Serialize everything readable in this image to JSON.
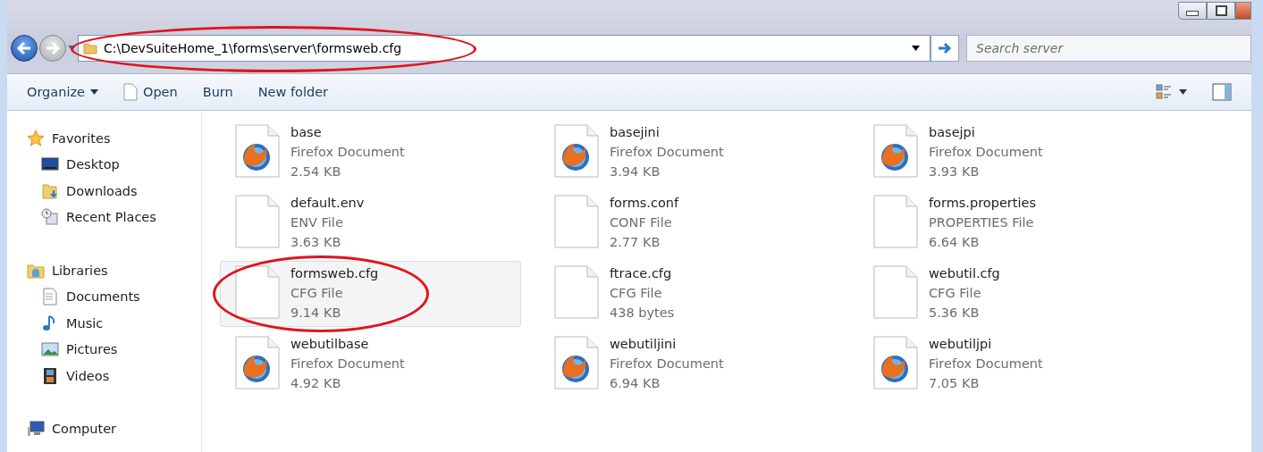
{
  "address_bar": {
    "value": "C:\\DevSuiteHome_1\\forms\\server\\formsweb.cfg",
    "circled": true
  },
  "search": {
    "placeholder": "Search server"
  },
  "toolbar": {
    "buttons": [
      "Organize",
      "Open",
      "Burn",
      "New folder"
    ]
  },
  "sidebar": {
    "groups": [
      {
        "label": "Favorites",
        "items": [
          {
            "label": "Desktop"
          },
          {
            "label": "Downloads"
          },
          {
            "label": "Recent Places"
          }
        ]
      },
      {
        "label": "Libraries",
        "items": [
          {
            "label": "Documents"
          },
          {
            "label": "Music"
          },
          {
            "label": "Pictures"
          },
          {
            "label": "Videos"
          }
        ]
      },
      {
        "label": "Computer"
      }
    ]
  },
  "files": [
    {
      "name": "base",
      "type": "Firefox Document",
      "size": "2.54 KB",
      "kind": "firefox",
      "selected": false,
      "circled": false
    },
    {
      "name": "basejini",
      "type": "Firefox Document",
      "size": "3.94 KB",
      "kind": "firefox",
      "selected": false,
      "circled": false
    },
    {
      "name": "basejpi",
      "type": "Firefox Document",
      "size": "3.93 KB",
      "kind": "firefox",
      "selected": false,
      "circled": false
    },
    {
      "name": "default.env",
      "type": "ENV File",
      "size": "3.63 KB",
      "kind": "blank",
      "selected": false,
      "circled": false
    },
    {
      "name": "forms.conf",
      "type": "CONF File",
      "size": "2.77 KB",
      "kind": "blank",
      "selected": false,
      "circled": false
    },
    {
      "name": "forms.properties",
      "type": "PROPERTIES File",
      "size": "6.64 KB",
      "kind": "blank",
      "selected": false,
      "circled": false
    },
    {
      "name": "formsweb.cfg",
      "type": "CFG File",
      "size": "9.14 KB",
      "kind": "blank",
      "selected": true,
      "circled": true
    },
    {
      "name": "ftrace.cfg",
      "type": "CFG File",
      "size": "438 bytes",
      "kind": "blank",
      "selected": false,
      "circled": false
    },
    {
      "name": "webutil.cfg",
      "type": "CFG File",
      "size": "5.36 KB",
      "kind": "blank",
      "selected": false,
      "circled": false
    },
    {
      "name": "webutilbase",
      "type": "Firefox Document",
      "size": "4.92 KB",
      "kind": "firefox",
      "selected": false,
      "circled": false
    },
    {
      "name": "webutiljini",
      "type": "Firefox Document",
      "size": "6.94 KB",
      "kind": "firefox",
      "selected": false,
      "circled": false
    },
    {
      "name": "webutiljpi",
      "type": "Firefox Document",
      "size": "7.05 KB",
      "kind": "firefox",
      "selected": false,
      "circled": false
    }
  ]
}
